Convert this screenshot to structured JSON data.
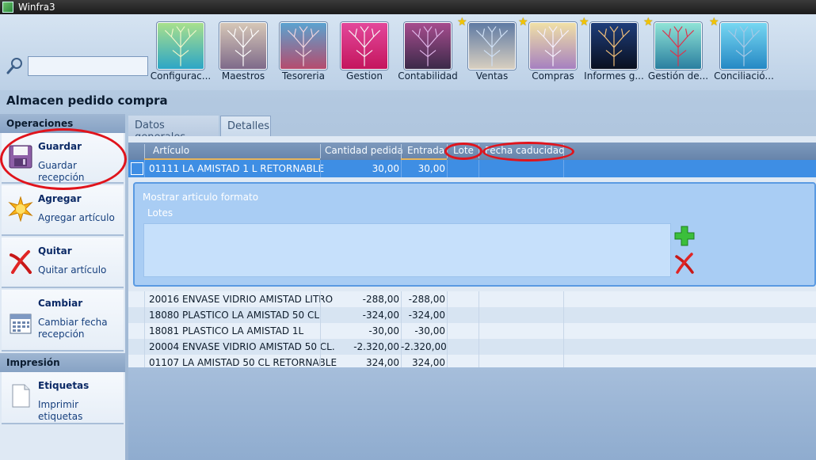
{
  "window": {
    "title": "Winfra3"
  },
  "search": {
    "placeholder": ""
  },
  "modules": [
    {
      "label": "Configurac...",
      "starred": false,
      "colors": [
        "#a8e08c",
        "#2ca6c6",
        "#f1f6c9"
      ]
    },
    {
      "label": "Maestros",
      "starred": false,
      "colors": [
        "#d6c7b7",
        "#7e6a8a",
        "#ffffff"
      ]
    },
    {
      "label": "Tesoreria",
      "starred": false,
      "colors": [
        "#5ba3d0",
        "#b54c6e",
        "#f2d7e0"
      ]
    },
    {
      "label": "Gestion",
      "starred": false,
      "colors": [
        "#e3489b",
        "#c4155d",
        "#f7f7f7"
      ]
    },
    {
      "label": "Contabilidad",
      "starred": false,
      "colors": [
        "#a64c8e",
        "#3b2a49",
        "#e0b6ea"
      ]
    },
    {
      "label": "Ventas",
      "starred": true,
      "colors": [
        "#5f7aa3",
        "#d8cfc0",
        "#cfe0f5"
      ]
    },
    {
      "label": "Compras",
      "starred": true,
      "colors": [
        "#f0e0a6",
        "#a680c0",
        "#f6f1ff"
      ]
    },
    {
      "label": "Informes g...",
      "starred": true,
      "colors": [
        "#1e3d7a",
        "#0a1020",
        "#f5c27a"
      ]
    },
    {
      "label": "Gestión de...",
      "starred": true,
      "colors": [
        "#8fe3d6",
        "#2a7fa0",
        "#e0314a"
      ]
    },
    {
      "label": "Conciliació...",
      "starred": true,
      "colors": [
        "#77d7f2",
        "#2588c4",
        "#a7c9e6"
      ]
    }
  ],
  "page": {
    "title": "Almacen pedido compra"
  },
  "sidebar": {
    "operations_header": "Operaciones",
    "print_header": "Impresión",
    "operations": [
      {
        "title": "Guardar",
        "subtitle": "Guardar recepción",
        "icon": "floppy-disk-icon"
      },
      {
        "title": "Agregar",
        "subtitle": "Agregar artículo",
        "icon": "sun-star-icon"
      },
      {
        "title": "Quitar",
        "subtitle": "Quitar artículo",
        "icon": "red-x-icon"
      },
      {
        "title": "Cambiar",
        "subtitle": "Cambiar fecha recepción",
        "icon": "calendar-icon"
      }
    ],
    "print_ops": [
      {
        "title": "Etiquetas",
        "subtitle": "Imprimir etiquetas",
        "icon": "document-icon"
      }
    ]
  },
  "tabs": [
    {
      "label": "Datos generales",
      "active": false
    },
    {
      "label": "Detalles",
      "active": true
    }
  ],
  "grid": {
    "columns": [
      "Artículo",
      "Cantidad pedida",
      "Entrada",
      "Lote",
      "Fecha caducidad"
    ],
    "selected_row": {
      "articulo": "01111 LA AMISTAD 1 L RETORNABLE",
      "cantidad": "30,00",
      "entrada": "30,00",
      "lote": "",
      "fecha": ""
    },
    "detail": {
      "title": "Mostrar articulo formato",
      "lotes_label": "Lotes"
    },
    "rows": [
      {
        "articulo": "20016 ENVASE VIDRIO AMISTAD LITRO",
        "cantidad": "-288,00",
        "entrada": "-288,00"
      },
      {
        "articulo": "18080 PLASTICO LA AMISTAD 50 CL",
        "cantidad": "-324,00",
        "entrada": "-324,00"
      },
      {
        "articulo": "18081 PLASTICO LA AMISTAD 1L",
        "cantidad": "-30,00",
        "entrada": "-30,00"
      },
      {
        "articulo": "20004 ENVASE VIDRIO AMISTAD 50 CL.",
        "cantidad": "-2.320,00",
        "entrada": "-2.320,00"
      },
      {
        "articulo": "01107 LA AMISTAD 50 CL RETORNABLE",
        "cantidad": "324,00",
        "entrada": "324,00"
      }
    ]
  },
  "annotations": {
    "color": "#e0141c"
  }
}
